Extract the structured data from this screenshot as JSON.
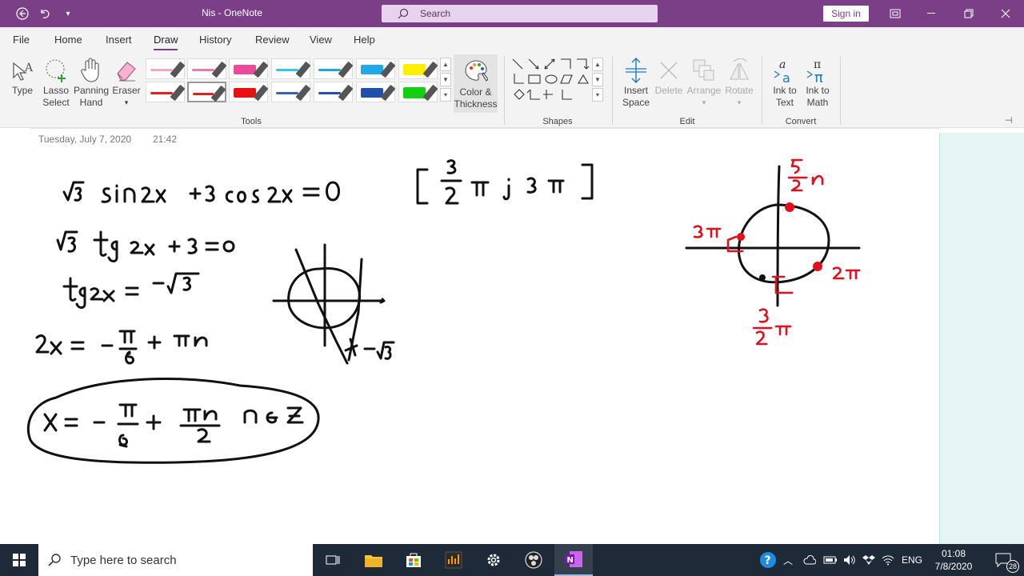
{
  "titlebar": {
    "title": "Nis  -  OneNote",
    "search_label": "Search",
    "signin_label": "Sign in"
  },
  "menu": [
    "File",
    "Home",
    "Insert",
    "Draw",
    "History",
    "Review",
    "View",
    "Help"
  ],
  "active_menu": "Draw",
  "tools": {
    "type": "Type",
    "lasso1": "Lasso",
    "lasso2": "Select",
    "pan1": "Panning",
    "pan2": "Hand",
    "eraser": "Eraser",
    "color1": "Color &",
    "color2": "Thickness",
    "group": "Tools"
  },
  "shapes": {
    "group": "Shapes"
  },
  "edit": {
    "insert1": "Insert",
    "insert2": "Space",
    "delete": "Delete",
    "arrange": "Arrange",
    "rotate": "Rotate",
    "group": "Edit"
  },
  "convert": {
    "ink_text1": "Ink to",
    "ink_text2": "Text",
    "ink_math1": "Ink to",
    "ink_math2": "Math",
    "group": "Convert"
  },
  "pens": {
    "row1": [
      "#f0a8c8",
      "#e87ab0",
      "#e84c9a",
      "#37c2e8",
      "#22a6d8",
      "#20a8e8",
      "#ffee00"
    ],
    "row2": [
      "#e02020",
      "#e02020",
      "#e81010",
      "#4060b0",
      "#2a4ea8",
      "#1f4fa8",
      "#10d010"
    ]
  },
  "page": {
    "date": "Tuesday, July 7, 2020",
    "time": "21:42"
  },
  "taskbar": {
    "search_placeholder": "Type here to search",
    "lang": "ENG",
    "time": "01:08",
    "date": "7/8/2020",
    "badge": "28"
  },
  "colors": {
    "accent": "#7b3f87",
    "ink": "#111111",
    "red_ink": "#e0101e"
  }
}
